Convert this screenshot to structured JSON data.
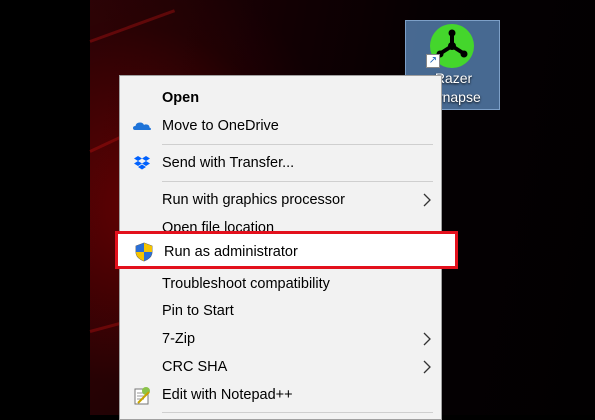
{
  "desktop": {
    "shortcut": {
      "label_line1": "Razer",
      "label_line2": "Synapse",
      "icon": "razer-synapse-icon",
      "logo_color": "#44d62c"
    }
  },
  "context_menu": {
    "items": [
      {
        "label": "Open",
        "bold": true,
        "icon": null,
        "submenu": false
      },
      {
        "label": "Move to OneDrive",
        "icon": "onedrive-icon",
        "submenu": false
      },
      {
        "label": "Send with Transfer...",
        "icon": "dropbox-icon",
        "submenu": false
      },
      {
        "label": "Run with graphics processor",
        "icon": null,
        "submenu": true
      },
      {
        "label": "Open file location",
        "icon": null,
        "submenu": false
      },
      {
        "label": "Run as administrator",
        "icon": "uac-shield-icon",
        "submenu": false,
        "highlighted": true
      },
      {
        "label": "Troubleshoot compatibility",
        "icon": null,
        "submenu": false
      },
      {
        "label": "Pin to Start",
        "icon": null,
        "submenu": false
      },
      {
        "label": "7-Zip",
        "icon": null,
        "submenu": true
      },
      {
        "label": "CRC SHA",
        "icon": null,
        "submenu": true
      },
      {
        "label": "Edit with Notepad++",
        "icon": "notepad-plus-plus-icon",
        "submenu": false
      }
    ]
  },
  "highlight_color": "#e3101c"
}
